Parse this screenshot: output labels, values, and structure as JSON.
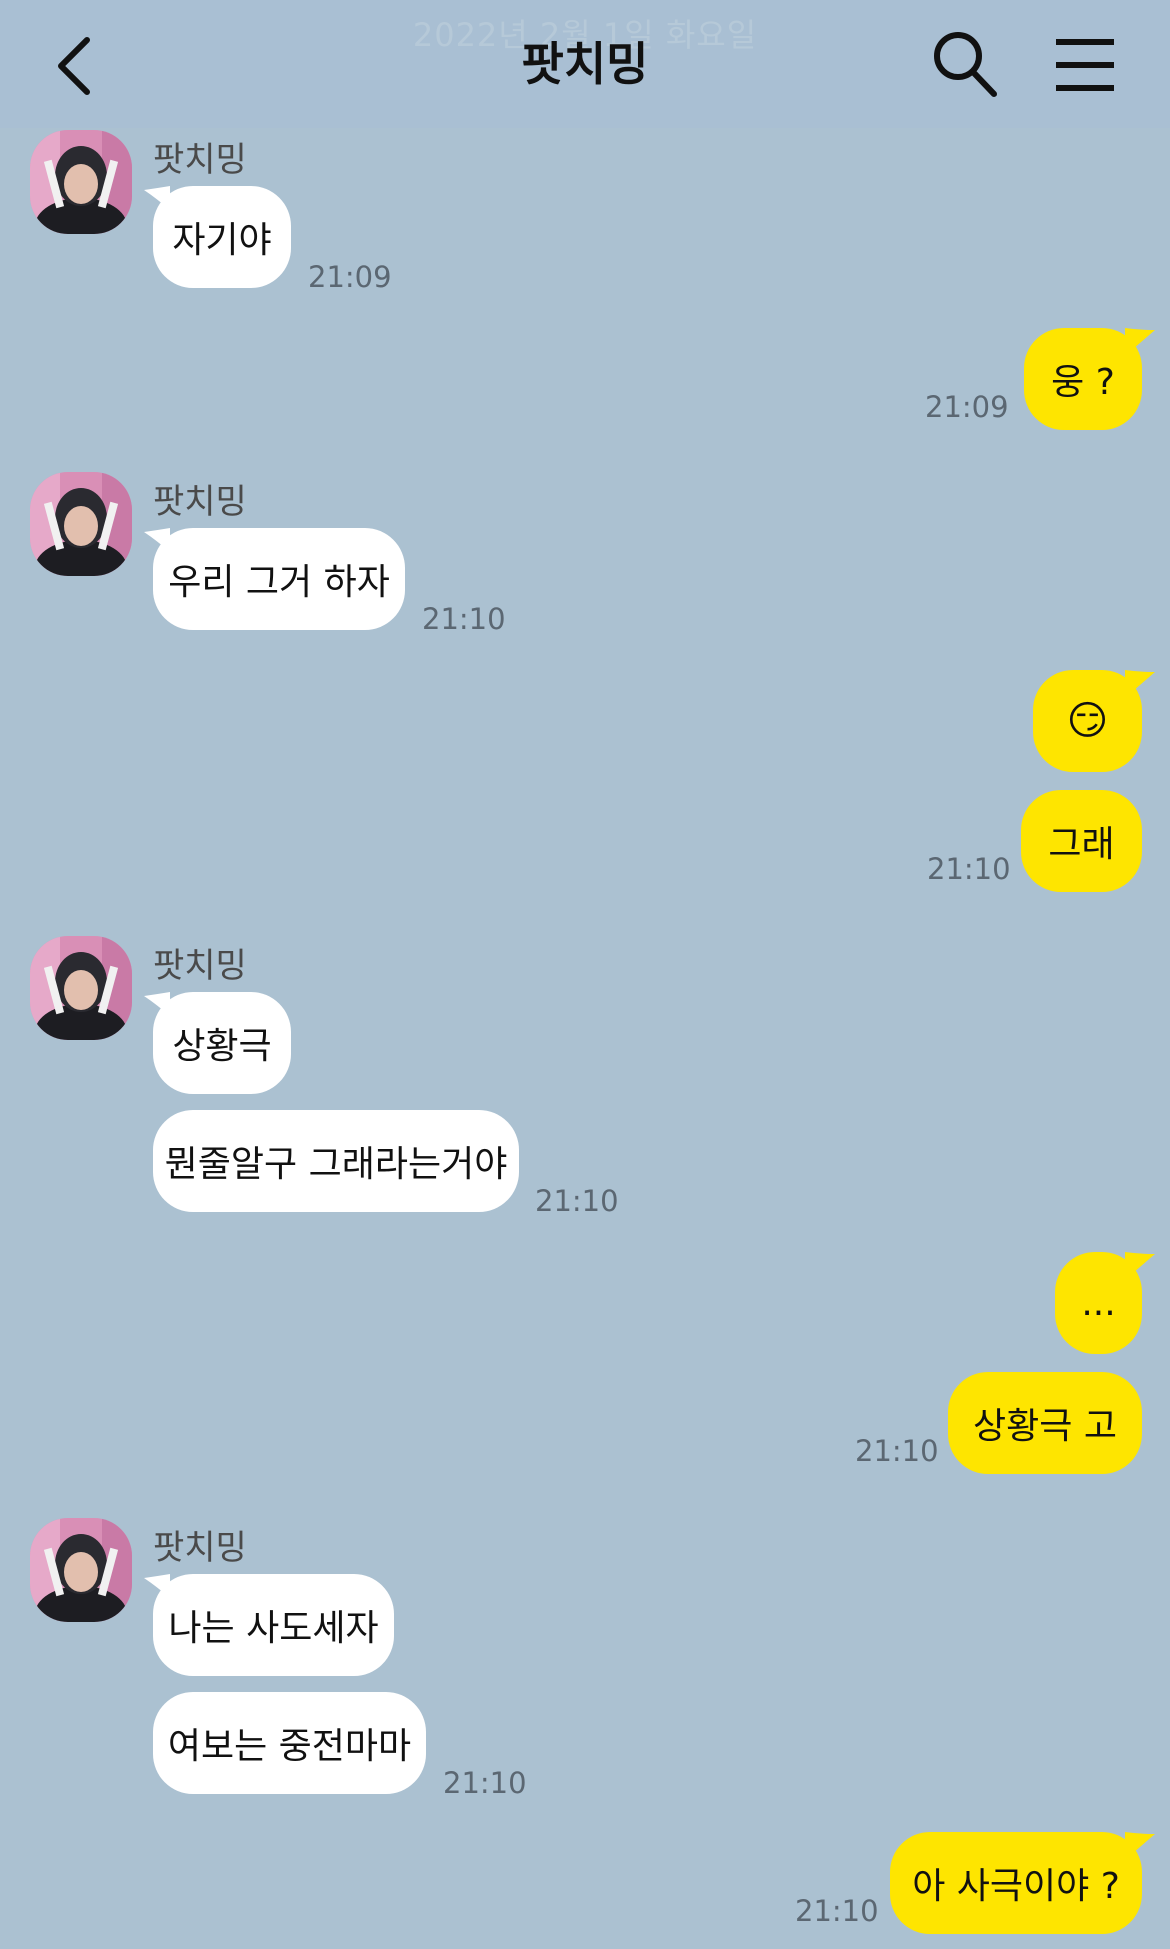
{
  "header": {
    "date_ghost": "2022년 2월 1일 화요일",
    "title": "팟치밍"
  },
  "icons": {
    "back": "chevron-left-icon",
    "search": "search-icon",
    "menu": "hamburger-menu-icon"
  },
  "colors": {
    "background": "#abc1d1",
    "incoming_bubble": "#ffffff",
    "outgoing_bubble": "#fee500",
    "time": "#5b6772"
  },
  "messages": [
    {
      "id": "m1",
      "direction": "in",
      "sender": "팟치밍",
      "text": "자기야",
      "time": "21:09"
    },
    {
      "id": "m2",
      "direction": "out",
      "text": "웅 ?",
      "time": "21:09"
    },
    {
      "id": "m3",
      "direction": "in",
      "sender": "팟치밍",
      "text": "우리 그거 하자",
      "time": "21:10"
    },
    {
      "id": "m4",
      "direction": "out",
      "text": "😏"
    },
    {
      "id": "m5",
      "direction": "out",
      "text": "그래",
      "time": "21:10"
    },
    {
      "id": "m6",
      "direction": "in",
      "sender": "팟치밍",
      "text": "상황극"
    },
    {
      "id": "m7",
      "direction": "in",
      "text": "뭔줄알구 그래라는거야",
      "time": "21:10"
    },
    {
      "id": "m8",
      "direction": "out",
      "text": "..."
    },
    {
      "id": "m9",
      "direction": "out",
      "text": "상황극 고",
      "time": "21:10"
    },
    {
      "id": "m10",
      "direction": "in",
      "sender": "팟치밍",
      "text": "나는 사도세자"
    },
    {
      "id": "m11",
      "direction": "in",
      "text": "여보는 중전마마",
      "time": "21:10"
    },
    {
      "id": "m12",
      "direction": "out",
      "text": "아 사극이야 ?",
      "time": "21:10"
    }
  ]
}
